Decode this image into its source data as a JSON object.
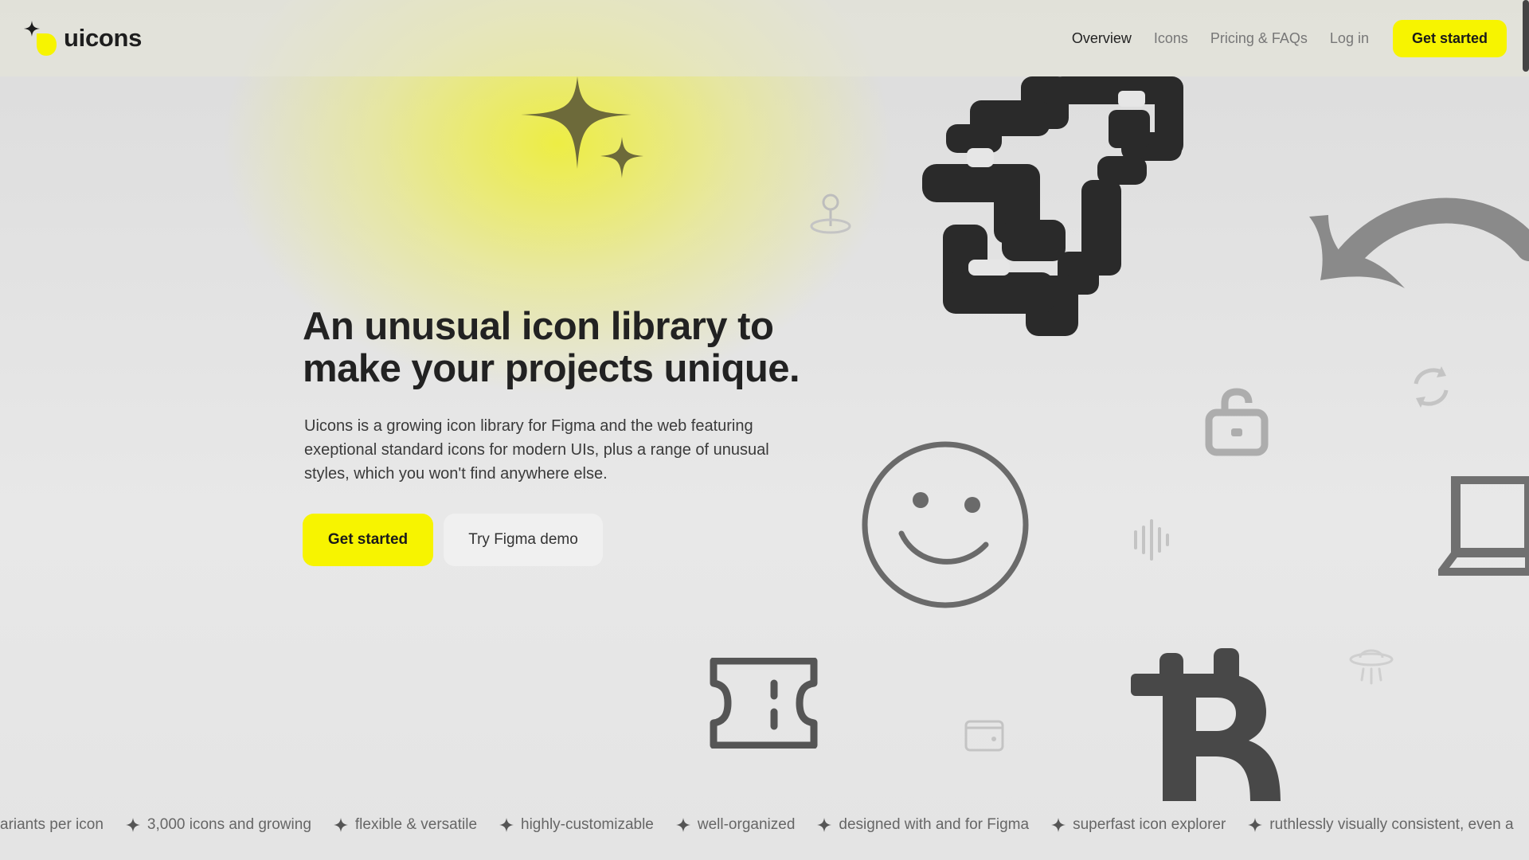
{
  "brand": {
    "name": "uicons",
    "accent": "#f7f400"
  },
  "nav": {
    "links": [
      "Overview",
      "Icons",
      "Pricing & FAQs",
      "Log in"
    ],
    "active": "Overview",
    "cta": "Get started"
  },
  "hero": {
    "title_line1": "An unusual icon library to",
    "title_line2": "make your projects unique.",
    "description_line1": "Uicons is a growing icon library for Figma and the web featuring",
    "description_line2": "exeptional standard icons for modern UIs, plus a range of unusual",
    "description_line3": "styles, which you won't find anywhere else.",
    "primary_cta": "Get started",
    "secondary_cta": "Try Figma demo"
  },
  "decorative_icons": [
    "sparkles-icon",
    "pixel-rocket-icon",
    "undo-arrow-icon",
    "location-pin-icon",
    "refresh-icon",
    "lock-icon",
    "smiley-icon",
    "soundwave-icon",
    "laptop-icon",
    "ticket-icon",
    "wallet-icon",
    "bitcoin-icon",
    "ufo-icon"
  ],
  "marquee": {
    "items": [
      "ariants per icon",
      "3,000 icons and growing",
      "flexible & versatile",
      "highly-customizable",
      "well-organized",
      "designed with and for Figma",
      "superfast icon explorer",
      "ruthlessly visually consistent, even a"
    ]
  }
}
